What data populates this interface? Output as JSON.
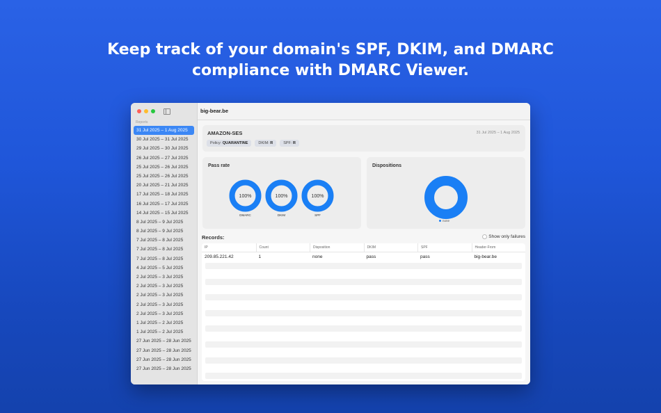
{
  "headline": {
    "line1": "Keep track of your domain's SPF, DKIM, and DMARC",
    "line2": "compliance with DMARC Viewer."
  },
  "window": {
    "title": "big-bear.be"
  },
  "sidebar": {
    "header": "Reports",
    "items": [
      "31 Jul 2025 – 1 Aug 2025",
      "30 Jul 2025 – 31 Jul 2025",
      "29 Jul 2025 – 30 Jul 2025",
      "26 Jul 2025 – 27 Jul 2025",
      "25 Jul 2025 – 26 Jul 2025",
      "25 Jul 2025 – 26 Jul 2025",
      "20 Jul 2025 – 21 Jul 2025",
      "17 Jul 2025 – 18 Jul 2025",
      "16 Jul 2025 – 17 Jul 2025",
      "14 Jul 2025 – 15 Jul 2025",
      "8 Jul 2025 – 9 Jul 2025",
      "8 Jul 2025 – 9 Jul 2025",
      "7 Jul 2025 – 8 Jul 2025",
      "7 Jul 2025 – 8 Jul 2025",
      "7 Jul 2025 – 8 Jul 2025",
      "4 Jul 2025 – 5 Jul 2025",
      "2 Jul 2025 – 3 Jul 2025",
      "2 Jul 2025 – 3 Jul 2025",
      "2 Jul 2025 – 3 Jul 2025",
      "2 Jul 2025 – 3 Jul 2025",
      "2 Jul 2025 – 3 Jul 2025",
      "1 Jul 2025 – 2 Jul 2025",
      "1 Jul 2025 – 2 Jul 2025",
      "27 Jun 2025 – 28 Jun 2025",
      "27 Jun 2025 – 28 Jun 2025",
      "27 Jun 2025 – 28 Jun 2025",
      "27 Jun 2025 – 28 Jun 2025"
    ],
    "selected_index": 0
  },
  "summary": {
    "source": "AMAZON-SES",
    "date_range": "31 Jul 2025 – 1 Aug 2025",
    "policy_label": "Policy:",
    "policy_value": "QUARANTINE",
    "dkim_label": "DKIM:",
    "dkim_value": "R",
    "spf_label": "SPF:",
    "spf_value": "R"
  },
  "pass_rate": {
    "title": "Pass rate",
    "rings": [
      {
        "label": "DMARC",
        "value_text": "100%",
        "fraction": 1.0
      },
      {
        "label": "DKIM",
        "value_text": "100%",
        "fraction": 1.0
      },
      {
        "label": "SPF",
        "value_text": "100%",
        "fraction": 1.0
      }
    ]
  },
  "dispositions": {
    "title": "Dispositions",
    "legend": "none"
  },
  "records": {
    "title": "Records:",
    "filter_label": "Show only failures",
    "columns": [
      "IP",
      "Count",
      "Disposition",
      "DKIM",
      "SPF",
      "Header-From"
    ],
    "rows": [
      [
        "209.85.221.42",
        "1",
        "none",
        "pass",
        "pass",
        "big-bear.be"
      ]
    ]
  },
  "colors": {
    "accent": "#1a7ff5",
    "selection": "#3b87f5",
    "background_top": "#2a62e6",
    "background_bottom": "#1442ad"
  }
}
